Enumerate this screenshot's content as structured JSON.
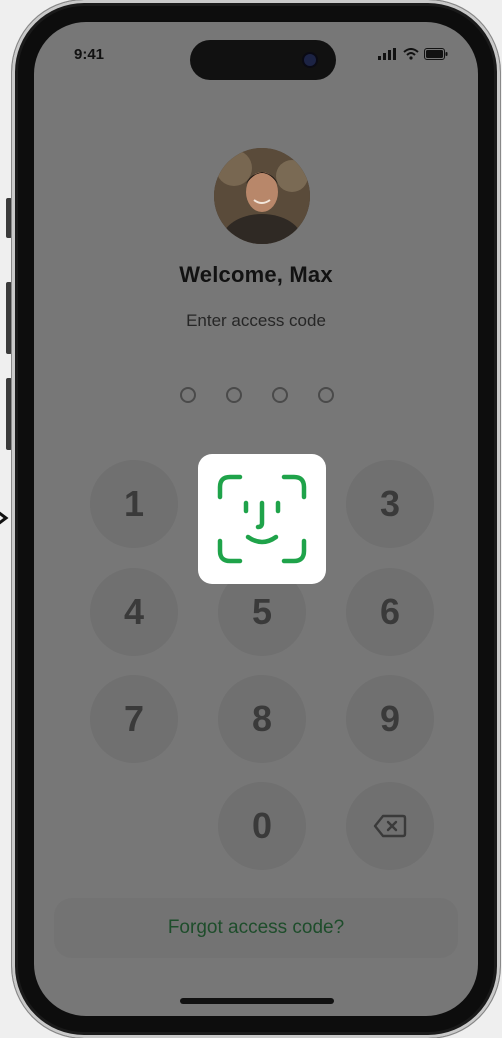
{
  "status_bar": {
    "time": "9:41",
    "icons": [
      "signal-icon",
      "wifi-icon",
      "battery-icon"
    ]
  },
  "user": {
    "welcome": "Welcome, Max",
    "prompt": "Enter access code"
  },
  "passcode": {
    "length": 4,
    "entered": 0
  },
  "keypad": {
    "k1": "1",
    "k3": "3",
    "k4": "4",
    "k5": "5",
    "k6": "6",
    "k7": "7",
    "k8": "8",
    "k9": "9",
    "k0": "0",
    "delete_icon": "backspace-icon",
    "faceid_icon": "face-id-icon"
  },
  "forgot": {
    "label": "Forgot access code?"
  },
  "colors": {
    "accent_green": "#1fa34a",
    "overlay_gray": "#777777",
    "face_id_bg": "#ffffff"
  }
}
